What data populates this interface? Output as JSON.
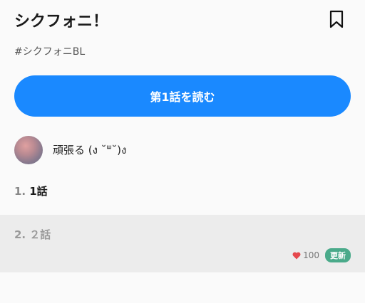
{
  "header": {
    "title": "シクフォニ！",
    "bookmark_icon": "bookmark-icon"
  },
  "tag": "#シクフォニBL",
  "read_button": {
    "label": "第1話を読む",
    "color": "#1a89ff"
  },
  "author": {
    "name": "頑張る (ง ˘ᐜ˘)ง"
  },
  "episodes": [
    {
      "number": "1.",
      "title": "1話"
    },
    {
      "number": "2.",
      "title": "２話",
      "likes": "100",
      "badge": "更新",
      "like_icon": "heart-icon"
    }
  ],
  "colors": {
    "badge": "#4aaa8a",
    "heart": "#e5484d"
  }
}
